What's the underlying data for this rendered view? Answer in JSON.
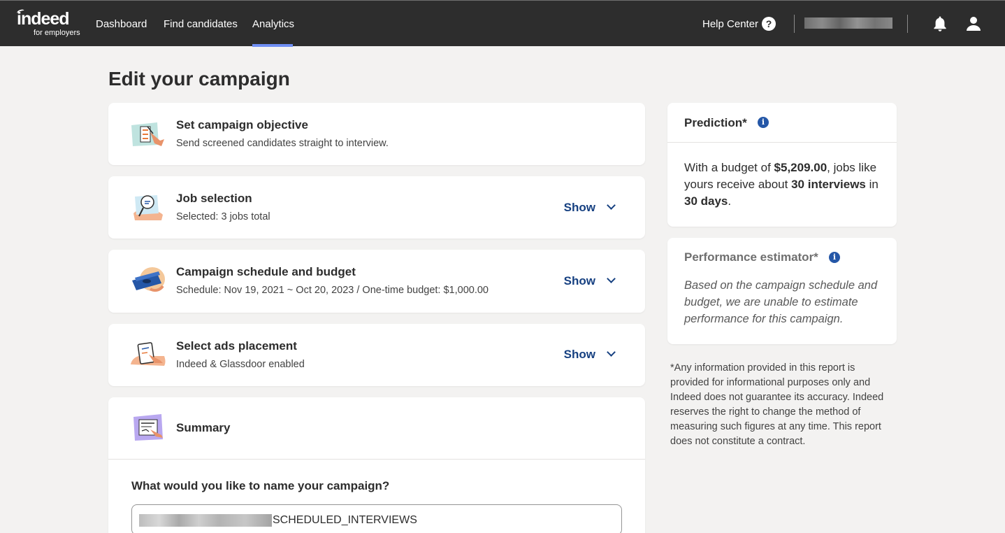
{
  "nav": {
    "logo_word": "indeed",
    "logo_sub": "for employers",
    "items": [
      "Dashboard",
      "Find candidates",
      "Analytics"
    ],
    "active": "Analytics",
    "help_label": "Help Center",
    "help_icon": "?"
  },
  "page": {
    "title": "Edit your campaign"
  },
  "steps": [
    {
      "title": "Set campaign objective",
      "subtitle": "Send screened candidates straight to interview.",
      "action": ""
    },
    {
      "title": "Job selection",
      "subtitle": "Selected: 3 jobs total",
      "action": "Show"
    },
    {
      "title": "Campaign schedule and budget",
      "subtitle": "Schedule: Nov 19, 2021 ~ Oct 20, 2023 / One-time budget: $1,000.00",
      "action": "Show"
    },
    {
      "title": "Select ads placement",
      "subtitle": "Indeed & Glassdoor enabled",
      "action": "Show"
    }
  ],
  "summary": {
    "title": "Summary",
    "name_question": "What would you like to name your campaign?",
    "name_value_visible": "SCHEDULED_INTERVIEWS"
  },
  "prediction": {
    "title": "Prediction*",
    "text_1": "With a budget of ",
    "budget": "$5,209.00",
    "text_2": ", jobs like yours receive about ",
    "interviews": "30 interviews",
    "text_3": " in ",
    "days": "30 days",
    "text_4": "."
  },
  "performance": {
    "title": "Performance estimator*",
    "body": "Based on the campaign schedule and budget, we are unable to estimate performance for this campaign."
  },
  "disclaimer": "*Any information provided in this report is provided for informational purposes only and Indeed does not guarantee its accuracy. Indeed reserves the right to change the method of measuring such figures at any time. This report does not constitute a contract.",
  "colors": {
    "topbar": "#2d2d2d",
    "active_tab": "#6f8ef3",
    "link": "#164081",
    "info": "#2557a7",
    "background": "#f3f2f1"
  }
}
